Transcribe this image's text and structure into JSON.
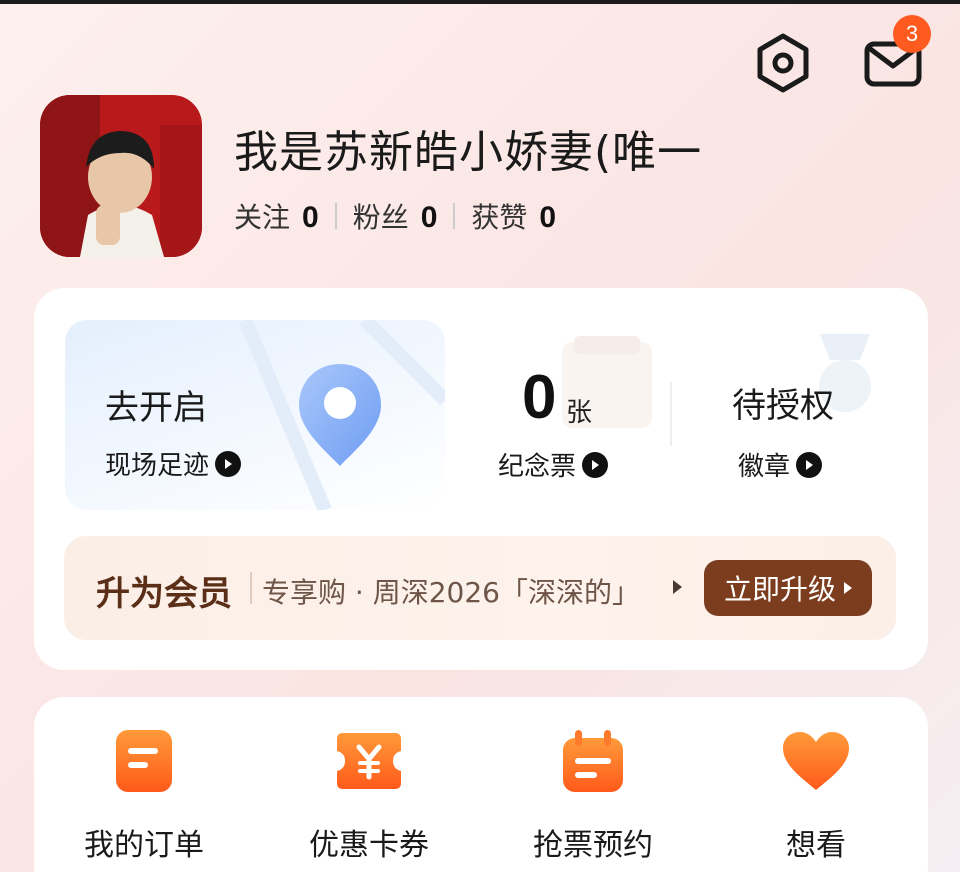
{
  "header": {
    "notification_count": "3"
  },
  "profile": {
    "name": "我是苏新皓小娇妻(唯一",
    "stats": [
      {
        "label": "关注",
        "value": "0"
      },
      {
        "label": "粉丝",
        "value": "0"
      },
      {
        "label": "获赞",
        "value": "0"
      }
    ]
  },
  "summary": {
    "footprint": {
      "title": "去开启",
      "label": "现场足迹"
    },
    "tickets": {
      "count": "0",
      "unit": "张",
      "label": "纪念票"
    },
    "badges": {
      "status": "待授权",
      "label": "徽章"
    }
  },
  "membership": {
    "title": "升为会员",
    "description": "专享购 · 周深2026「深深的」",
    "button": "立即升级"
  },
  "quick_actions": [
    {
      "label": "我的订单",
      "icon": "order-icon"
    },
    {
      "label": "优惠卡券",
      "icon": "coupon-icon"
    },
    {
      "label": "抢票预约",
      "icon": "calendar-icon"
    },
    {
      "label": "想看",
      "icon": "heart-icon"
    }
  ],
  "colors": {
    "accent_orange": "#ff6a1a",
    "brown": "#7b3d1e",
    "badge": "#ff5a1f"
  }
}
